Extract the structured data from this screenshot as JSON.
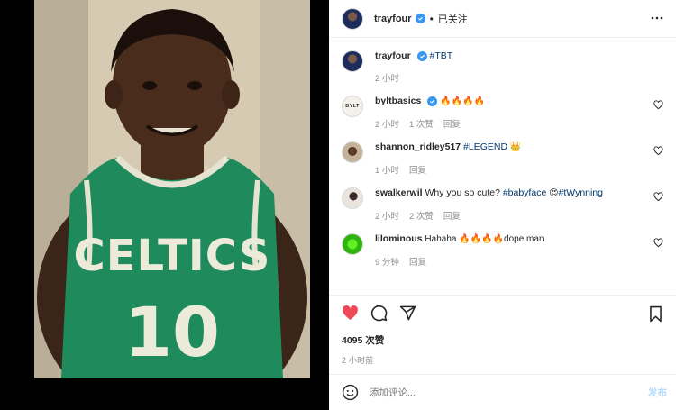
{
  "media": {
    "jersey_text": "CELTICS",
    "jersey_number": "10"
  },
  "header": {
    "username": "trayfour",
    "follow_status": "已关注",
    "separator": "•"
  },
  "caption": {
    "username": "trayfour",
    "text": "#TBT",
    "time": "2 小时"
  },
  "comments": [
    {
      "username": "byltbasics",
      "verified": true,
      "text": "🔥🔥🔥🔥",
      "time": "2 小时",
      "likes": "1 次赞",
      "reply": "回复",
      "avatar_text": "BYLT"
    },
    {
      "username": "shannon_ridley517",
      "verified": false,
      "text_link": "#LEGEND",
      "text": " 👑",
      "time": "1 小时",
      "likes": "",
      "reply": "回复"
    },
    {
      "username": "swalkerwil",
      "verified": false,
      "text_pre": "Why you so cute? ",
      "text_link": "#babyface",
      "text_mid": " 😍",
      "text_link2": "#tWynning",
      "time": "2 小时",
      "likes": "2 次赞",
      "reply": "回复"
    },
    {
      "username": "lilominous",
      "verified": false,
      "text": "Hahaha 🔥🔥🔥🔥dope man",
      "time": "9 分钟",
      "likes": "",
      "reply": "回复"
    }
  ],
  "actions": {
    "likes_count": "4095 次赞",
    "post_time": "2 小时前"
  },
  "add_comment": {
    "placeholder": "添加评论...",
    "post_label": "发布"
  },
  "colors": {
    "heart": "#ed4956",
    "verified": "#3897f0",
    "link": "#00376b",
    "post_button": "#b3dbff",
    "jersey_green": "#1f8a5c"
  },
  "icons": [
    "more-icon",
    "heart-icon",
    "comment-icon",
    "share-icon",
    "bookmark-icon",
    "emoji-icon",
    "verified-icon"
  ]
}
